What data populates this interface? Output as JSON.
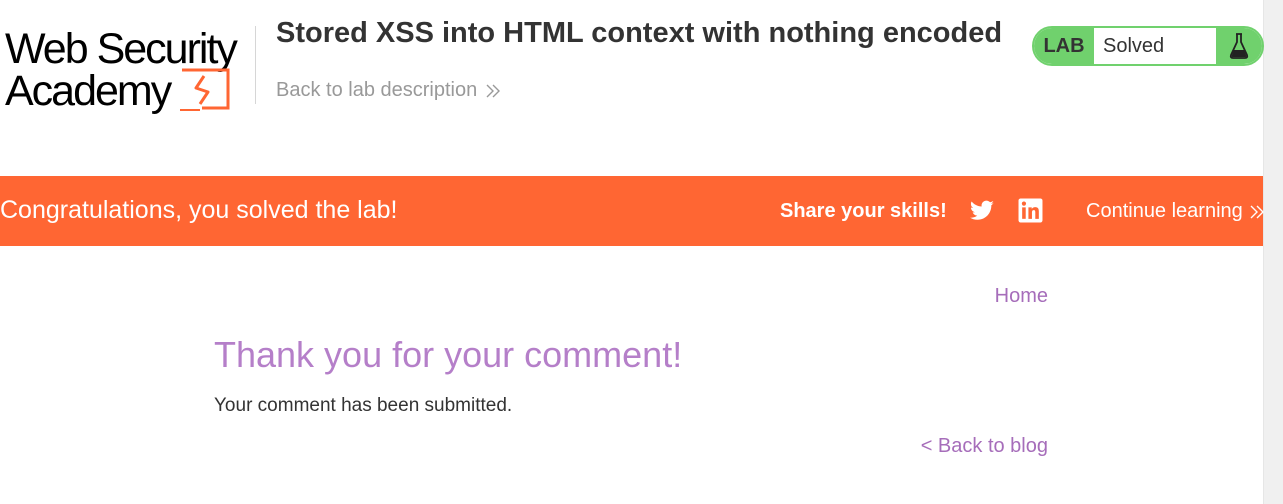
{
  "header": {
    "logo": {
      "line1": "Web Security",
      "line2": "Academy"
    },
    "lab_title": "Stored XSS into HTML context with nothing encoded",
    "back_link": "Back to lab description",
    "back_link_icon": "double-chevron-right-icon"
  },
  "status_widget": {
    "badge": "LAB",
    "status": "Solved",
    "icon": "flask-icon",
    "color": "#70d16d"
  },
  "banner": {
    "message": "Congratulations, you solved the lab!",
    "share_label": "Share your skills!",
    "share_icons": [
      "twitter-icon",
      "linkedin-icon"
    ],
    "continue_label": "Continue learning",
    "continue_icon": "double-chevron-right-icon",
    "color": "#ff6633"
  },
  "nav": {
    "home": "Home"
  },
  "main": {
    "heading": "Thank you for your comment!",
    "message": "Your comment has been submitted.",
    "back_link": "< Back to blog"
  },
  "colors": {
    "accent": "#a66dba",
    "heading": "#b57fc9",
    "text": "#333333",
    "muted": "#999999"
  }
}
